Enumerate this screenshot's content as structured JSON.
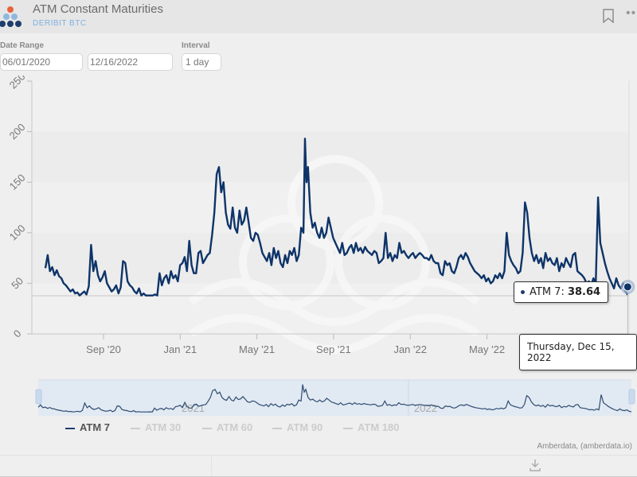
{
  "header": {
    "title": "ATM Constant Maturities",
    "subtitle": "DERIBIT BTC",
    "bookmark_icon": "bookmark-icon",
    "more_icon": "more-icon"
  },
  "controls": {
    "date_range_label": "Date Range",
    "start_date": "06/01/2020",
    "end_date": "12/16/2022",
    "interval_label": "Interval",
    "interval_value": "1 day"
  },
  "tooltip": {
    "series": "ATM 7",
    "value": "38.64",
    "date": "Thursday, Dec 15, 2022"
  },
  "legend": [
    {
      "label": "ATM 7",
      "active": true
    },
    {
      "label": "ATM 30",
      "active": false
    },
    {
      "label": "ATM 60",
      "active": false
    },
    {
      "label": "ATM 90",
      "active": false
    },
    {
      "label": "ATM 180",
      "active": false
    }
  ],
  "credit": "Amberdata, (amberdata.io)",
  "footer": {
    "download_icon": "download-icon"
  },
  "colors": {
    "series": "#0e3468",
    "accent": "#7fb0e0"
  },
  "chart_data": {
    "type": "line",
    "title": "ATM Constant Maturities",
    "xlabel": "",
    "ylabel": "",
    "ylim": [
      0,
      250
    ],
    "yticks": [
      "0",
      "50",
      "100",
      "150",
      "200",
      "250"
    ],
    "xticks": [
      "Sep '20",
      "Jan '21",
      "May '21",
      "Sep '21",
      "Jan '22",
      "May '22"
    ],
    "xrange": [
      "2020-06-01",
      "2022-12-15"
    ],
    "navigator_labels": [
      "2021",
      "2022"
    ],
    "grid": true,
    "legend_position": "bottom",
    "series": [
      {
        "name": "ATM 7",
        "unit_x": "days since 2020-06-01",
        "points": [
          [
            0,
            65
          ],
          [
            3,
            78
          ],
          [
            6,
            62
          ],
          [
            9,
            66
          ],
          [
            12,
            58
          ],
          [
            15,
            63
          ],
          [
            18,
            57
          ],
          [
            21,
            55
          ],
          [
            24,
            50
          ],
          [
            27,
            48
          ],
          [
            30,
            45
          ],
          [
            33,
            42
          ],
          [
            36,
            44
          ],
          [
            39,
            40
          ],
          [
            42,
            41
          ],
          [
            45,
            38
          ],
          [
            48,
            40
          ],
          [
            51,
            42
          ],
          [
            54,
            39
          ],
          [
            57,
            47
          ],
          [
            60,
            88
          ],
          [
            63,
            62
          ],
          [
            66,
            72
          ],
          [
            69,
            58
          ],
          [
            72,
            52
          ],
          [
            75,
            56
          ],
          [
            78,
            62
          ],
          [
            81,
            50
          ],
          [
            84,
            46
          ],
          [
            87,
            42
          ],
          [
            90,
            44
          ],
          [
            93,
            48
          ],
          [
            96,
            40
          ],
          [
            99,
            46
          ],
          [
            102,
            72
          ],
          [
            105,
            70
          ],
          [
            108,
            52
          ],
          [
            111,
            48
          ],
          [
            114,
            46
          ],
          [
            117,
            42
          ],
          [
            120,
            40
          ],
          [
            123,
            45
          ],
          [
            126,
            38
          ],
          [
            129,
            40
          ],
          [
            132,
            38
          ],
          [
            135,
            38
          ],
          [
            138,
            38
          ],
          [
            141,
            38
          ],
          [
            144,
            39
          ],
          [
            147,
            38
          ],
          [
            150,
            60
          ],
          [
            153,
            48
          ],
          [
            156,
            55
          ],
          [
            159,
            58
          ],
          [
            162,
            50
          ],
          [
            165,
            62
          ],
          [
            168,
            55
          ],
          [
            171,
            58
          ],
          [
            174,
            52
          ],
          [
            177,
            68
          ],
          [
            180,
            70
          ],
          [
            183,
            76
          ],
          [
            186,
            62
          ],
          [
            189,
            92
          ],
          [
            192,
            68
          ],
          [
            195,
            60
          ],
          [
            198,
            60
          ],
          [
            201,
            80
          ],
          [
            204,
            82
          ],
          [
            207,
            70
          ],
          [
            210,
            74
          ],
          [
            213,
            78
          ],
          [
            216,
            80
          ],
          [
            219,
            98
          ],
          [
            222,
            120
          ],
          [
            225,
            158
          ],
          [
            228,
            165
          ],
          [
            231,
            140
          ],
          [
            234,
            150
          ],
          [
            237,
            120
          ],
          [
            240,
            108
          ],
          [
            243,
            104
          ],
          [
            246,
            125
          ],
          [
            249,
            105
          ],
          [
            252,
            100
          ],
          [
            255,
            122
          ],
          [
            258,
            108
          ],
          [
            261,
            112
          ],
          [
            264,
            125
          ],
          [
            267,
            110
          ],
          [
            270,
            95
          ],
          [
            273,
            92
          ],
          [
            276,
            100
          ],
          [
            279,
            98
          ],
          [
            282,
            90
          ],
          [
            285,
            80
          ],
          [
            288,
            76
          ],
          [
            291,
            72
          ],
          [
            294,
            80
          ],
          [
            297,
            68
          ],
          [
            300,
            85
          ],
          [
            303,
            75
          ],
          [
            306,
            82
          ],
          [
            309,
            70
          ],
          [
            312,
            66
          ],
          [
            315,
            78
          ],
          [
            318,
            70
          ],
          [
            321,
            82
          ],
          [
            324,
            78
          ],
          [
            327,
            85
          ],
          [
            330,
            72
          ],
          [
            333,
            78
          ],
          [
            336,
            105
          ],
          [
            339,
            100
          ],
          [
            341,
            193
          ],
          [
            343,
            150
          ],
          [
            345,
            165
          ],
          [
            348,
            120
          ],
          [
            351,
            105
          ],
          [
            354,
            110
          ],
          [
            357,
            100
          ],
          [
            360,
            95
          ],
          [
            363,
            105
          ],
          [
            366,
            95
          ],
          [
            369,
            100
          ],
          [
            372,
            115
          ],
          [
            375,
            105
          ],
          [
            378,
            95
          ],
          [
            381,
            90
          ],
          [
            384,
            85
          ],
          [
            387,
            80
          ],
          [
            390,
            90
          ],
          [
            393,
            78
          ],
          [
            396,
            80
          ],
          [
            399,
            85
          ],
          [
            402,
            88
          ],
          [
            405,
            80
          ],
          [
            408,
            90
          ],
          [
            411,
            82
          ],
          [
            414,
            85
          ],
          [
            417,
            80
          ],
          [
            420,
            86
          ],
          [
            423,
            82
          ],
          [
            426,
            80
          ],
          [
            429,
            78
          ],
          [
            432,
            82
          ],
          [
            435,
            80
          ],
          [
            438,
            70
          ],
          [
            441,
            72
          ],
          [
            444,
            75
          ],
          [
            447,
            100
          ],
          [
            450,
            75
          ],
          [
            453,
            80
          ],
          [
            456,
            72
          ],
          [
            459,
            78
          ],
          [
            462,
            75
          ],
          [
            465,
            90
          ],
          [
            468,
            80
          ],
          [
            471,
            82
          ],
          [
            474,
            78
          ],
          [
            477,
            75
          ],
          [
            480,
            78
          ],
          [
            483,
            80
          ],
          [
            486,
            75
          ],
          [
            489,
            78
          ],
          [
            492,
            80
          ],
          [
            495,
            78
          ],
          [
            498,
            75
          ],
          [
            501,
            75
          ],
          [
            504,
            73
          ],
          [
            507,
            78
          ],
          [
            510,
            72
          ],
          [
            513,
            70
          ],
          [
            516,
            70
          ],
          [
            519,
            60
          ],
          [
            522,
            58
          ],
          [
            525,
            72
          ],
          [
            528,
            68
          ],
          [
            531,
            70
          ],
          [
            534,
            62
          ],
          [
            537,
            60
          ],
          [
            540,
            66
          ],
          [
            543,
            75
          ],
          [
            546,
            78
          ],
          [
            549,
            74
          ],
          [
            552,
            80
          ],
          [
            555,
            76
          ],
          [
            558,
            70
          ],
          [
            561,
            66
          ],
          [
            564,
            62
          ],
          [
            567,
            60
          ],
          [
            570,
            58
          ],
          [
            573,
            55
          ],
          [
            576,
            58
          ],
          [
            579,
            52
          ],
          [
            582,
            55
          ],
          [
            585,
            50
          ],
          [
            588,
            52
          ],
          [
            591,
            58
          ],
          [
            594,
            55
          ],
          [
            597,
            60
          ],
          [
            600,
            55
          ],
          [
            603,
            62
          ],
          [
            606,
            100
          ],
          [
            609,
            78
          ],
          [
            612,
            72
          ],
          [
            615,
            68
          ],
          [
            618,
            65
          ],
          [
            621,
            60
          ],
          [
            624,
            62
          ],
          [
            627,
            80
          ],
          [
            630,
            130
          ],
          [
            633,
            120
          ],
          [
            636,
            95
          ],
          [
            639,
            80
          ],
          [
            642,
            72
          ],
          [
            645,
            78
          ],
          [
            648,
            70
          ],
          [
            651,
            75
          ],
          [
            654,
            65
          ],
          [
            657,
            80
          ],
          [
            660,
            72
          ],
          [
            663,
            75
          ],
          [
            666,
            70
          ],
          [
            669,
            68
          ],
          [
            672,
            75
          ],
          [
            675,
            62
          ],
          [
            678,
            70
          ],
          [
            681,
            66
          ],
          [
            684,
            75
          ],
          [
            687,
            70
          ],
          [
            690,
            66
          ],
          [
            693,
            78
          ],
          [
            696,
            80
          ],
          [
            699,
            62
          ],
          [
            702,
            60
          ],
          [
            705,
            58
          ],
          [
            708,
            55
          ],
          [
            711,
            50
          ],
          [
            714,
            52
          ],
          [
            717,
            48
          ],
          [
            720,
            55
          ],
          [
            723,
            50
          ],
          [
            726,
            135
          ],
          [
            729,
            90
          ],
          [
            732,
            80
          ],
          [
            735,
            70
          ],
          [
            738,
            62
          ],
          [
            741,
            55
          ],
          [
            744,
            50
          ],
          [
            747,
            45
          ],
          [
            750,
            55
          ],
          [
            753,
            48
          ],
          [
            756,
            45
          ],
          [
            759,
            50
          ],
          [
            762,
            42
          ],
          [
            765,
            38.64
          ]
        ]
      }
    ]
  }
}
